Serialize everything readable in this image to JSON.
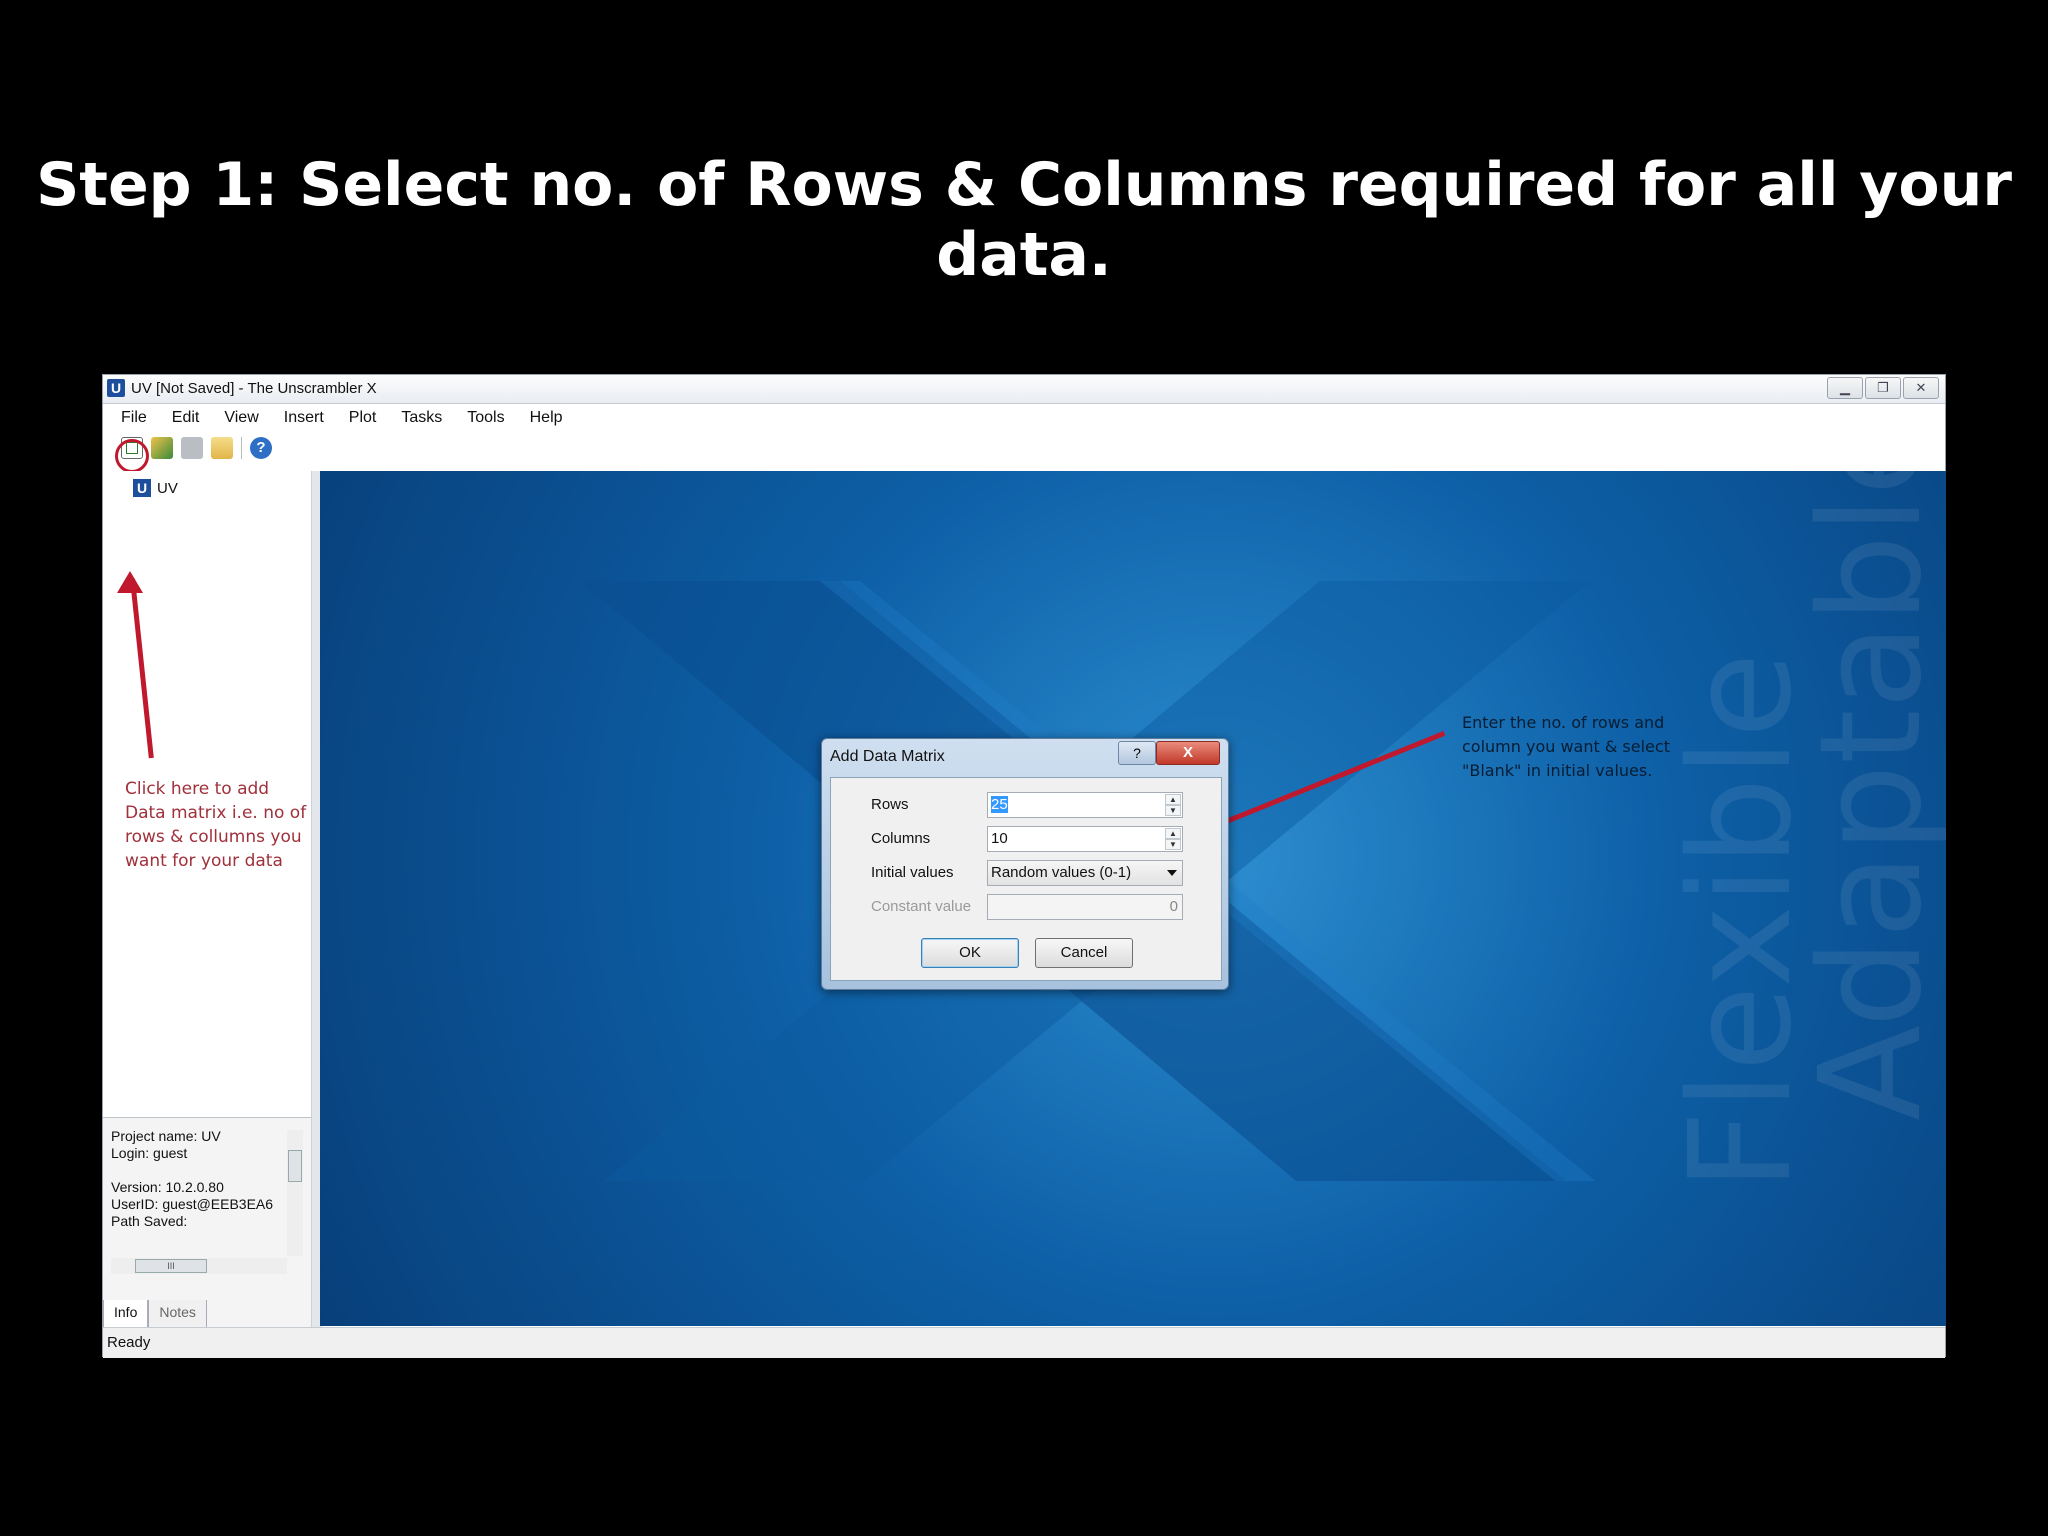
{
  "slide": {
    "title": "Step 1: Select no. of Rows & Columns required for all your data."
  },
  "window": {
    "title": "UV [Not Saved] - The Unscrambler X",
    "app_icon": "U",
    "controls": [
      "minimize-icon",
      "restore-icon",
      "close-icon"
    ]
  },
  "menu": [
    "File",
    "Edit",
    "View",
    "Insert",
    "Plot",
    "Tasks",
    "Tools",
    "Help"
  ],
  "toolbar": {
    "icons": [
      "add-data-matrix-icon",
      "import-icon",
      "save-icon",
      "open-folder-icon",
      "help-icon"
    ],
    "help_glyph": "?"
  },
  "tree": {
    "icon": "U",
    "label": "UV"
  },
  "annotations": {
    "left": "Click here to add Data matrix i.e. no of rows & collumns you want for your data",
    "right": "Enter the no. of rows and column you want & select \"Blank\" in initial values."
  },
  "info_panel": {
    "text": "Project name: UV\nLogin: guest\n\nVersion: 10.2.0.80\nUserID: guest@EEB3EA6\nPath Saved:",
    "tabs": [
      "Info",
      "Notes"
    ],
    "hscroll_glyph": "III"
  },
  "status": "Ready",
  "workspace": {
    "watermark_words": [
      "Flexible",
      "Adaptable"
    ],
    "colors": {
      "background": "#0d5fa6",
      "accent": "#2d8ed0"
    }
  },
  "dialog": {
    "title": "Add Data Matrix",
    "help_glyph": "?",
    "close_glyph": "X",
    "rows_label": "Rows",
    "rows_value": "25",
    "columns_label": "Columns",
    "columns_value": "10",
    "initial_values_label": "Initial values",
    "initial_values_value": "Random values  (0-1)",
    "constant_value_label": "Constant value",
    "constant_value_value": "0",
    "ok_label": "OK",
    "cancel_label": "Cancel"
  }
}
